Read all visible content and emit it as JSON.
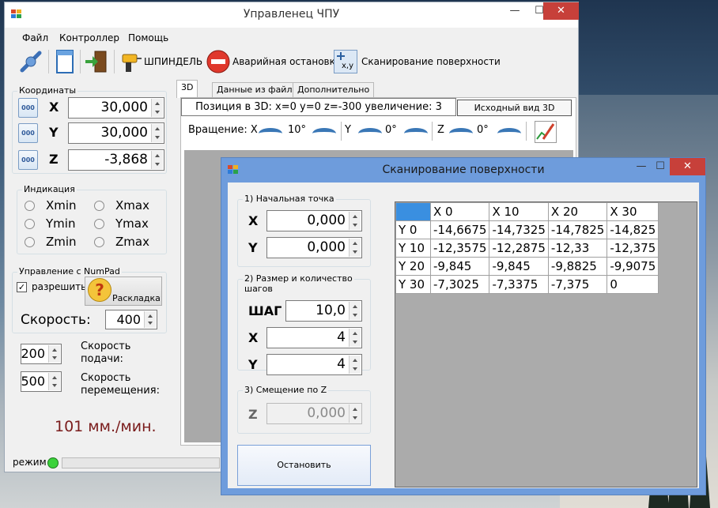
{
  "main_window": {
    "title": "Управленец ЧПУ",
    "caption": {
      "minimize": "—",
      "maximize": "☐",
      "close": "✕"
    },
    "menu": [
      "Файл",
      "Контроллер",
      "Помощь"
    ],
    "toolbar": {
      "spindle": "ШПИНДЕЛЬ",
      "emergency_stop": "Аварийная остановка",
      "scan_surface": "Сканирование поверхности",
      "scan_icon_text": "x,y"
    },
    "coords": {
      "legend": "Координаты",
      "axis_button_text": "000",
      "axes": [
        {
          "label": "X",
          "value": "30,000"
        },
        {
          "label": "Y",
          "value": "30,000"
        },
        {
          "label": "Z",
          "value": "-3,868"
        }
      ]
    },
    "indication": {
      "legend": "Индикация",
      "items": [
        "Xmin",
        "Xmax",
        "Ymin",
        "Ymax",
        "Zmin",
        "Zmax"
      ]
    },
    "numpad": {
      "legend": "Управление с NumPad",
      "enable_label": "разрешить",
      "enable_checked": true,
      "layout_button": "Раскладка",
      "speed_label": "Скорость:",
      "speed_value": "400"
    },
    "feed": {
      "value": "200",
      "label_line1": "Скорость",
      "label_line2": "подачи:"
    },
    "travel": {
      "value": "500",
      "label_line1": "Скорость",
      "label_line2": "перемещения:"
    },
    "speed_readout": "101 мм./мин.",
    "tabs": [
      "3D",
      "Данные из файла",
      "Дополнительно"
    ],
    "view3d": {
      "position_text": "Позиция в 3D: x=0 y=0 z=-300 увеличение: 3",
      "reset_button": "Исходный вид 3D",
      "rotation_label": "Вращение: X",
      "rx": "10°",
      "y_label": "Y",
      "ry": "0°",
      "z_label": "Z",
      "rz": "0°"
    },
    "status": {
      "mode_label": "режим"
    }
  },
  "scan_dialog": {
    "title": "Сканирование поверхности",
    "caption": {
      "minimize": "—",
      "maximize": "☐",
      "close": "✕"
    },
    "start_point": {
      "legend": "1) Начальная точка",
      "x_label": "X",
      "x_value": "0,000",
      "y_label": "Y",
      "y_value": "0,000"
    },
    "size_steps": {
      "legend_line1": "2) Размер и количество",
      "legend_line2": "шагов",
      "step_label": "ШАГ",
      "step_value": "10,0",
      "x_label": "X",
      "x_value": "4",
      "y_label": "Y",
      "y_value": "4"
    },
    "offset": {
      "legend": "3) Смещение по Z",
      "z_label": "Z",
      "z_value": "0,000"
    },
    "stop_button": "Остановить",
    "grid": {
      "columns": [
        "X 0",
        "X 10",
        "X 20",
        "X 30"
      ],
      "rows": [
        {
          "label": "Y 0",
          "values": [
            "-14,6675",
            "-14,7325",
            "-14,7825",
            "-14,825"
          ]
        },
        {
          "label": "Y 10",
          "values": [
            "-12,3575",
            "-12,2875",
            "-12,33",
            "-12,375"
          ]
        },
        {
          "label": "Y 20",
          "values": [
            "-9,845",
            "-9,845",
            "-9,8825",
            "-9,9075"
          ]
        },
        {
          "label": "Y 30",
          "values": [
            "-7,3025",
            "-7,3375",
            "-7,375",
            "0"
          ]
        }
      ]
    }
  },
  "colors": {
    "accent": "#3a8fe0",
    "close": "#c7403a",
    "speed_readout": "#7a1c1c",
    "dialog_frame": "#6e9cdc"
  }
}
